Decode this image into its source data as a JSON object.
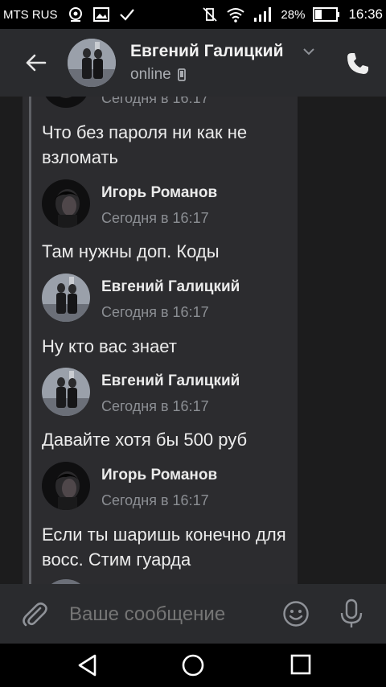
{
  "status_bar": {
    "carrier": "MTS RUS",
    "battery": "28%",
    "time": "16:36"
  },
  "header": {
    "contact_name": "Евгений Галицкий",
    "status": "online",
    "icons": [
      "back-arrow-icon",
      "chevron-down-icon",
      "phone-status-icon",
      "phone-icon"
    ]
  },
  "messages": {
    "partial_top_time": "Сегодня в 16:17",
    "items": [
      {
        "type": "text",
        "text": "Что без пароля ни как не взломать"
      },
      {
        "type": "author",
        "name": "Игорь Романов",
        "time": "Сегодня в 16:17"
      },
      {
        "type": "text",
        "text": "Там нужны доп. Коды"
      },
      {
        "type": "author",
        "name": "Евгений Галицкий",
        "time": "Сегодня в 16:17"
      },
      {
        "type": "text",
        "text": "Ну кто вас знает"
      },
      {
        "type": "author",
        "name": "Евгений Галицкий",
        "time": "Сегодня в 16:17"
      },
      {
        "type": "text",
        "text": "Давайте хотя бы 500 руб"
      },
      {
        "type": "author",
        "name": "Игорь Романов",
        "time": "Сегодня в 16:17"
      },
      {
        "type": "text",
        "text": "Если ты шаришь конечно для восс. Стим гуарда"
      }
    ]
  },
  "input": {
    "placeholder": "Ваше сообщение"
  },
  "colors": {
    "header_bg": "#2a2b2e",
    "chat_bg": "#1c1c1d",
    "forward_bg": "#2c2c2f",
    "muted_text": "#8b8e93"
  }
}
